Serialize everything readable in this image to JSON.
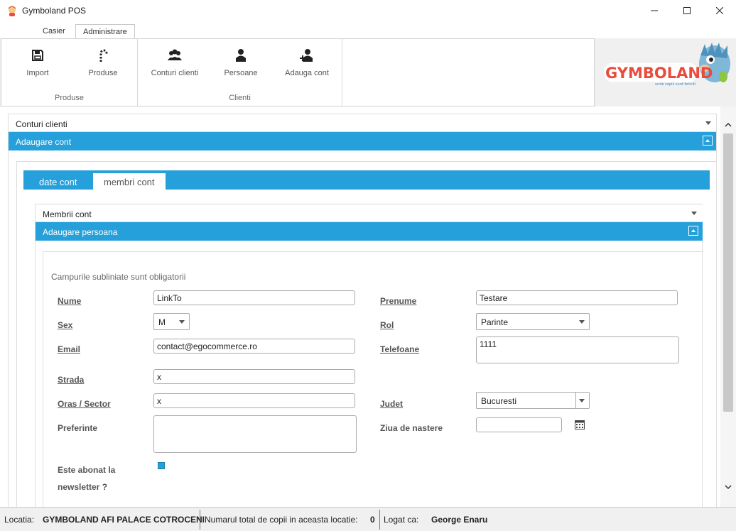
{
  "window": {
    "title": "Gymboland POS"
  },
  "ribbon": {
    "tabs": [
      "Casier",
      "Administrare"
    ],
    "active_tab": "Administrare",
    "groups": [
      {
        "label": "Produse",
        "buttons": [
          "Import",
          "Produse"
        ]
      },
      {
        "label": "Clienti",
        "buttons": [
          "Conturi clienti",
          "Persoane",
          "Adauga cont"
        ]
      }
    ]
  },
  "logo": {
    "text": "GYMBOLAND",
    "tagline": "unde copiii sunt fericiti"
  },
  "accordion": {
    "item1": "Conturi clienti",
    "item2": "Adaugare cont"
  },
  "content_tabs": [
    "date cont",
    "membri cont"
  ],
  "sub_accordion": {
    "item1": "Membrii cont",
    "item2": "Adaugare persoana"
  },
  "form": {
    "hint": "Campurile subliniate sunt obligatorii",
    "nume": {
      "label": "Nume",
      "value": "LinkTo"
    },
    "prenume": {
      "label": "Prenume",
      "value": "Testare"
    },
    "sex": {
      "label": "Sex",
      "value": "M"
    },
    "rol": {
      "label": "Rol",
      "value": "Parinte"
    },
    "email": {
      "label": "Email",
      "value": "contact@egocommerce.ro"
    },
    "telefoane": {
      "label": "Telefoane",
      "value": "1111"
    },
    "strada": {
      "label": "Strada",
      "value": "x"
    },
    "oras": {
      "label": "Oras / Sector",
      "value": "x"
    },
    "judet": {
      "label": "Judet",
      "value": "Bucuresti"
    },
    "preferinte": {
      "label": "Preferinte",
      "value": ""
    },
    "ziua": {
      "label": "Ziua de nastere",
      "value": ""
    },
    "newsletter": {
      "label_line1": "Este abonat la",
      "label_line2": "newsletter ?",
      "checked": true
    }
  },
  "statusbar": {
    "locatia_label": "Locatia:",
    "locatia_value": "GYMBOLAND AFI PALACE COTROCENI",
    "copii_label": "Numarul total de copii in aceasta locatie:",
    "copii_value": "0",
    "logat_label": "Logat ca:",
    "logat_value": "George Enaru"
  },
  "colors": {
    "accent": "#25a0da"
  }
}
